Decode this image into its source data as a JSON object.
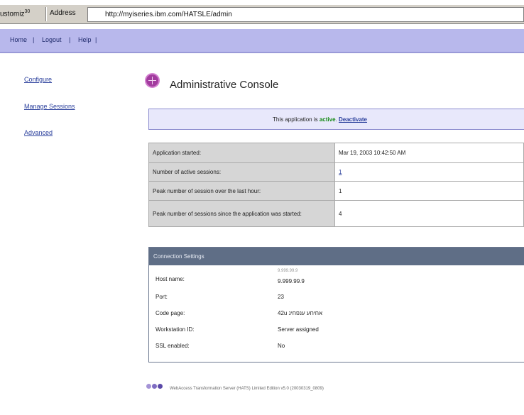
{
  "browser": {
    "customize_label": "ustomiz",
    "customize_badge": "30",
    "address_label": "Address",
    "url": "http://myiseries.ibm.com/HATSLE/admin"
  },
  "topnav": {
    "items": [
      "Home",
      "Logout",
      "Help"
    ],
    "separator": "|"
  },
  "sidebar": {
    "items": [
      "Configure",
      "Manage Sessions",
      "Advanced"
    ]
  },
  "header": {
    "icon": "globe-icon",
    "title": "Administrative Console"
  },
  "status": {
    "prefix": "This application is",
    "state": "active",
    "action": "Deactivate"
  },
  "stats": [
    {
      "label": "Application started:",
      "value": "Mar 19, 2003 10:42:50 AM"
    },
    {
      "label": "Number of active sessions:",
      "value": "1"
    },
    {
      "label": "Peak number of session over the last hour:",
      "value": "1"
    },
    {
      "label": "Peak number of sessions since the application was started:",
      "value": "4"
    }
  ],
  "connection": {
    "title": "Connection Settings",
    "faint_line": "9.999.99.9",
    "rows": [
      {
        "label": "Host name:",
        "value": "9.999.99.9"
      },
      {
        "label": "Port:",
        "value": "23"
      },
      {
        "label": "Code page:",
        "value": "42u אחיחע ענפחינ"
      },
      {
        "label": "Workstation ID:",
        "value": "Server assigned"
      },
      {
        "label": "SSL enabled:",
        "value": "No"
      }
    ]
  },
  "footer": {
    "text": "WebAccess Transformation Server (HATS) Limited Edition v5.0 (20030319_0809)"
  },
  "colors": {
    "nav_band": "#b8b8ec",
    "banner_bg": "#e8e8fb",
    "active_green": "#138a13",
    "link_blue": "#2a3f9c",
    "conn_header": "#5f6e86",
    "footer_dots": [
      "#a493d6",
      "#7e6cc2",
      "#5b49a8"
    ]
  }
}
